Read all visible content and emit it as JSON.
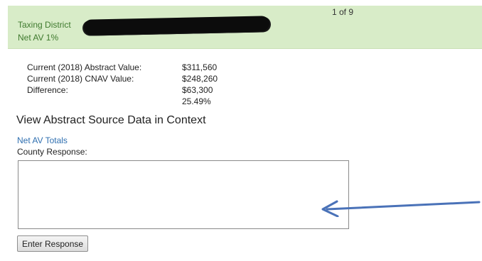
{
  "header": {
    "district_label": "Taxing District",
    "net_av_label": "Net AV 1%",
    "page_count": "1 of 9"
  },
  "values": [
    {
      "label": "Current (2018) Abstract Value:",
      "value": "$311,560"
    },
    {
      "label": "Current (2018) CNAV Value:",
      "value": "$248,260"
    },
    {
      "label": "Difference:",
      "value": "$63,300"
    },
    {
      "label": "",
      "value": "25.49%"
    }
  ],
  "view_link": "View Abstract Source Data in Context",
  "net_av_totals": "Net AV Totals",
  "county_response_label": "County Response:",
  "response_value": "",
  "enter_button": "Enter Response",
  "colors": {
    "header_bg": "#d8ecc8",
    "header_text": "#3f7a2e",
    "link": "#2f6fb0",
    "arrow": "#4a72b8"
  }
}
